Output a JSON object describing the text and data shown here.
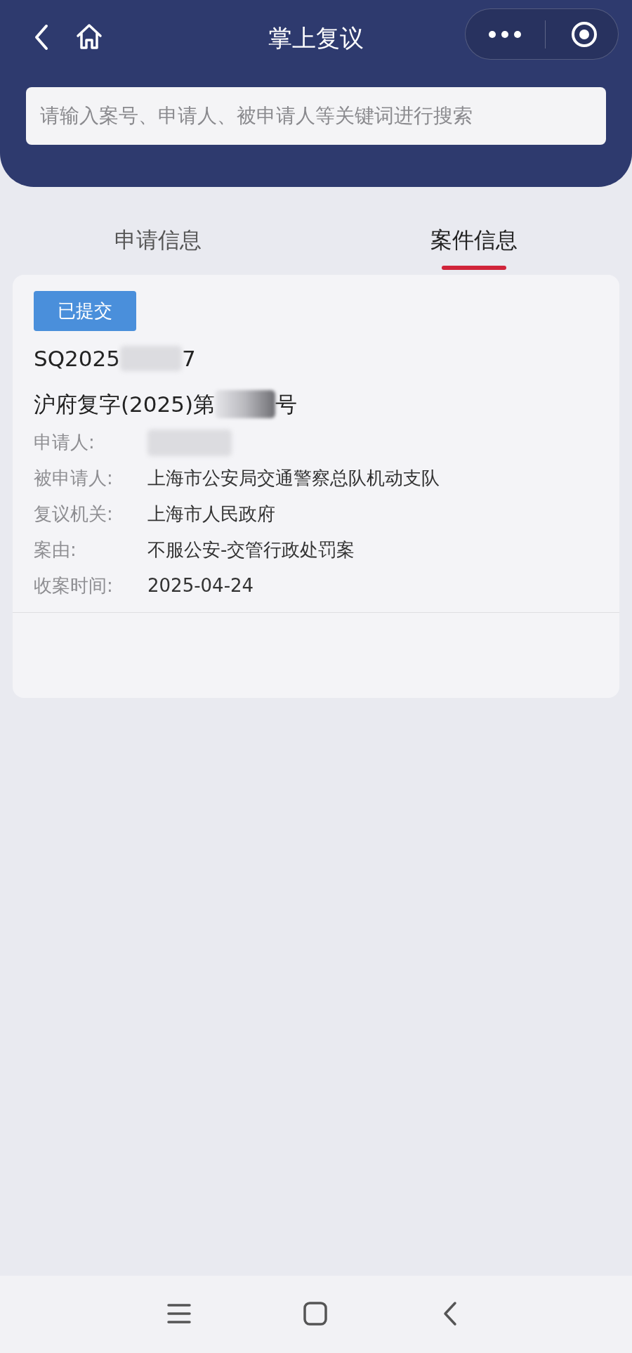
{
  "header": {
    "title": "掌上复议"
  },
  "search": {
    "placeholder": "请输入案号、申请人、被申请人等关键词进行搜索"
  },
  "tabs": [
    {
      "label": "申请信息",
      "selected": false
    },
    {
      "label": "案件信息",
      "selected": true
    }
  ],
  "case": {
    "status": "已提交",
    "number_start": "SQ2025",
    "number_end": "7",
    "title_start": "沪府复字(2025)第",
    "title_end": "号",
    "fields": [
      {
        "label": "申请人:"
      },
      {
        "label": "被申请人:",
        "value": "上海市公安局交通警察总队机动支队"
      },
      {
        "label": "复议机关:",
        "value": "上海市人民政府"
      },
      {
        "label": "案由:",
        "value": "不服公安-交管行政处罚案"
      },
      {
        "label": "收案时间:",
        "value": "2025-04-24"
      }
    ]
  }
}
